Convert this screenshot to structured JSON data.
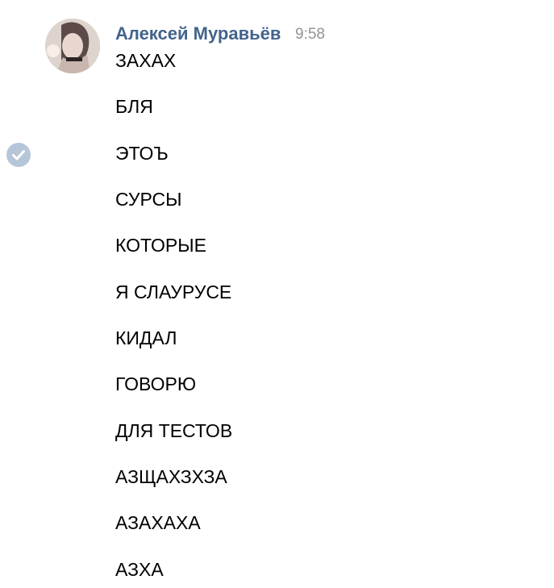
{
  "post": {
    "author": "Алексей Муравьёв",
    "time": "9:58"
  },
  "messages": [
    "ЗАХАХ",
    "БЛЯ",
    "ЭТОЪ",
    "СУРСЫ",
    "КОТОРЫЕ",
    "Я СЛАУРУСЕ",
    "КИДАЛ",
    "ГОВОРЮ",
    "ДЛЯ ТЕСТОВ",
    "АЗЩАХЗХЗА",
    "АЗАХАХА",
    "АЗХА"
  ],
  "colors": {
    "author": "#42648b",
    "time": "#939393",
    "check_circle": "#b5c6d9",
    "text": "#000000"
  },
  "icons": {
    "check": "check-circle-icon",
    "avatar": "avatar-photo"
  }
}
